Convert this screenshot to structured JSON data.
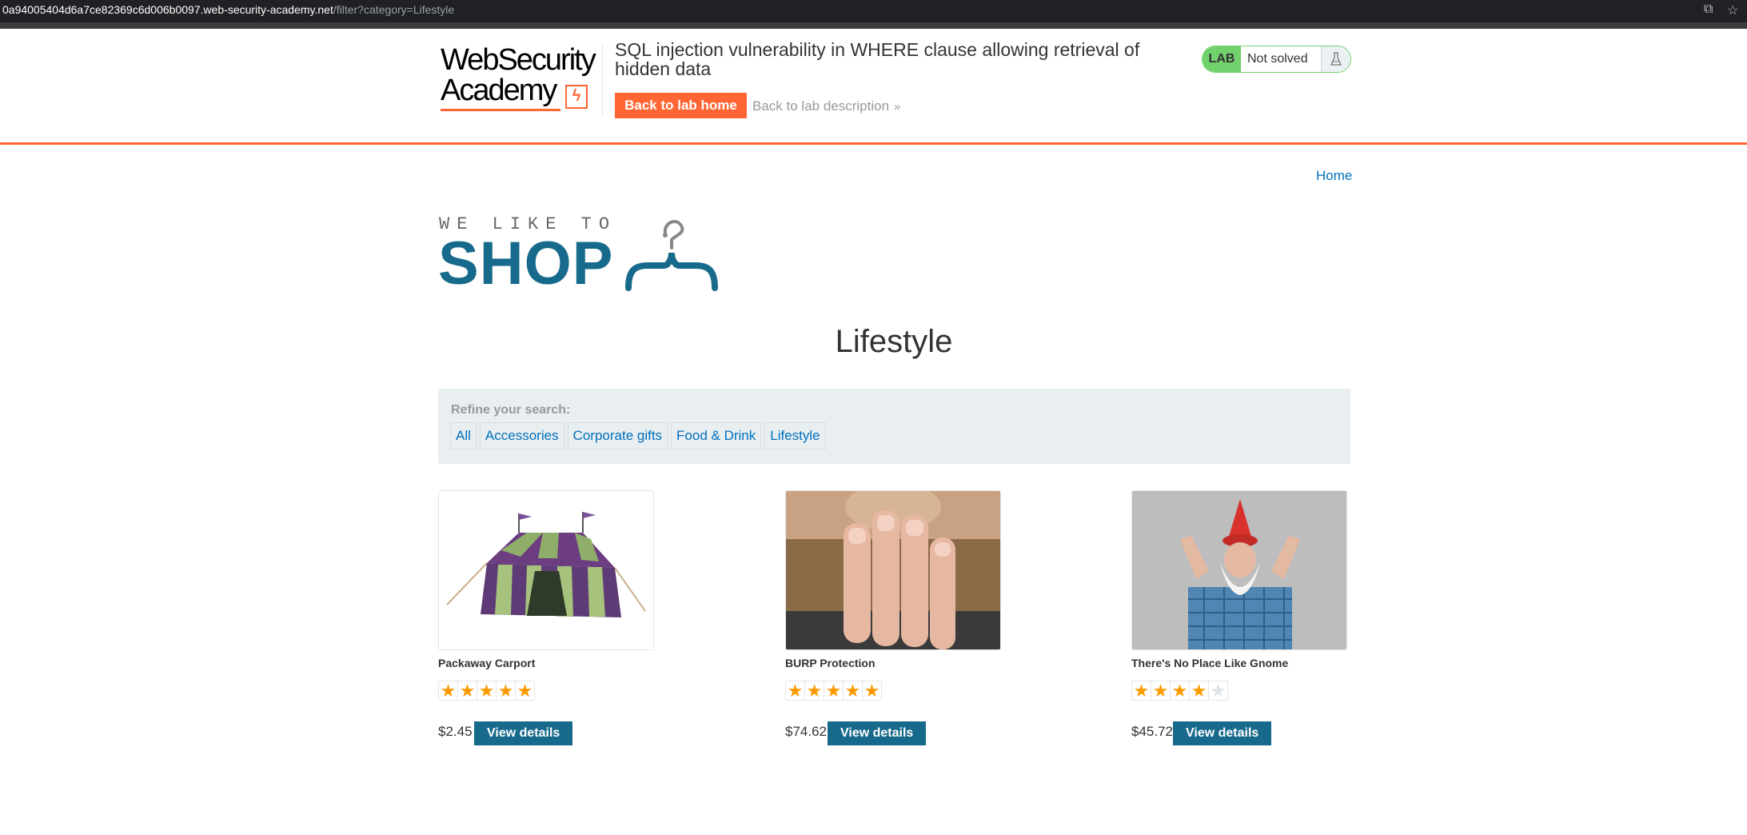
{
  "browser": {
    "url_host": "0a94005404d6a7ce82369c6d006b0097.web-security-academy.net",
    "url_path": "/filter?category=Lifestyle"
  },
  "academy": {
    "logo_line1": "WebSecurity",
    "logo_line2": "Academy",
    "lab_title": "SQL injection vulnerability in WHERE clause allowing retrieval of hidden data",
    "back_home_label": "Back to lab home",
    "back_description_label": "Back to lab description",
    "status_tag": "LAB",
    "status_text": "Not solved",
    "accent_color": "#ff6633",
    "status_color": "#70d16d"
  },
  "site": {
    "home_link": "Home",
    "logo_small": "WE LIKE TO",
    "logo_big": "SHOP",
    "page_title": "Lifestyle",
    "brand_color": "#176a8b"
  },
  "filter": {
    "label": "Refine your search:",
    "categories": [
      "All",
      "Accessories",
      "Corporate gifts",
      "Food & Drink",
      "Lifestyle"
    ]
  },
  "products": [
    {
      "name": "Packaway Carport",
      "rating": 5,
      "price": "$2.45",
      "button": "View details",
      "image": "tent-image"
    },
    {
      "name": "BURP Protection",
      "rating": 5,
      "price": "$74.62",
      "button": "View details",
      "image": "beard-hand-image"
    },
    {
      "name": "There's No Place Like Gnome",
      "rating": 4,
      "price": "$45.72",
      "button": "View details",
      "image": "gnome-man-image"
    }
  ]
}
